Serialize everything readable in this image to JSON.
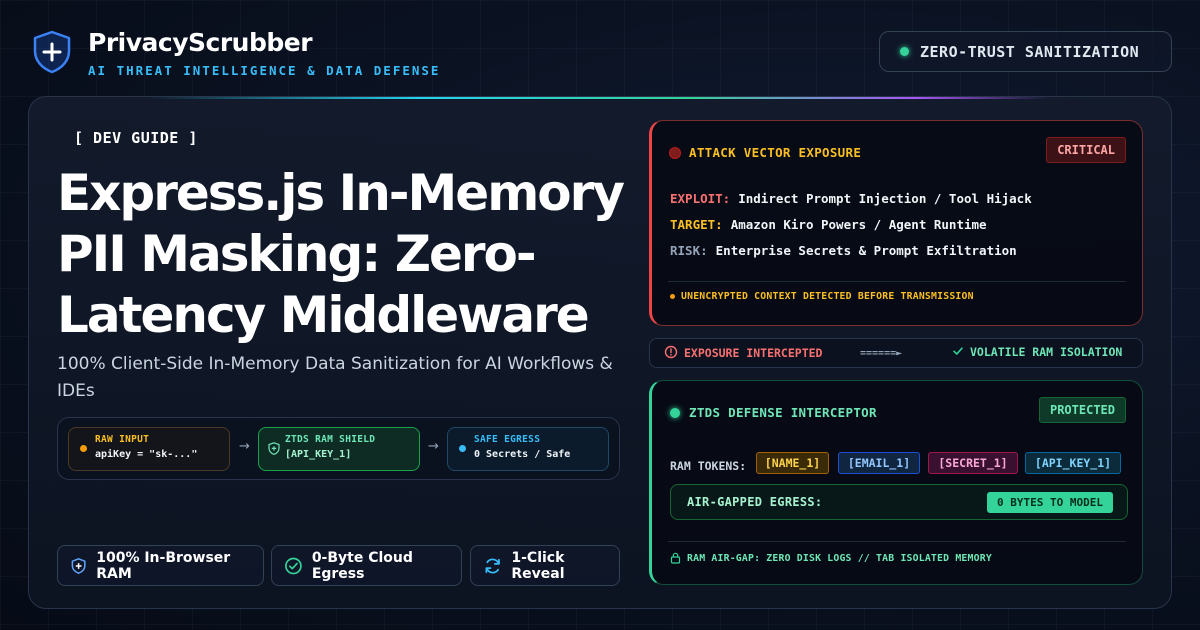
{
  "brand": {
    "name": "PrivacyScrubber",
    "tagline": "AI THREAT INTELLIGENCE & DATA DEFENSE",
    "status_pill": "ZERO-TRUST SANITIZATION"
  },
  "hero": {
    "tag": "[ DEV GUIDE ]",
    "headline": "Express.js In-Memory PII Masking: Zero-Latency Middleware",
    "subhead": "100% Client-Side In-Memory Data Sanitization for AI Workflows & IDEs"
  },
  "flow": {
    "steps": [
      {
        "title": "RAW INPUT",
        "value": "apiKey = \"sk-...\""
      },
      {
        "title": "ZTDS RAM SHIELD",
        "value": "[API_KEY_1]"
      },
      {
        "title": "SAFE EGRESS",
        "value": "0 Secrets / Safe"
      }
    ],
    "arrow": "→"
  },
  "features": [
    {
      "label": "100% In-Browser RAM",
      "icon": "shield-plus-icon"
    },
    {
      "label": "0-Byte Cloud Egress",
      "icon": "check-circle-icon"
    },
    {
      "label": "1-Click Reveal",
      "icon": "refresh-icon"
    }
  ],
  "attack_card": {
    "title": "ATTACK VECTOR EXPOSURE",
    "badge": "CRITICAL",
    "rows": [
      {
        "key": "EXPLOIT:",
        "value": "Indirect Prompt Injection / Tool Hijack"
      },
      {
        "key": "TARGET:",
        "value": "Amazon Kiro Powers / Agent Runtime"
      },
      {
        "key": "RISK:",
        "value": "Enterprise Secrets & Prompt Exfiltration"
      }
    ],
    "footer": "UNENCRYPTED CONTEXT DETECTED BEFORE TRANSMISSION"
  },
  "intercept_strip": {
    "left": "EXPOSURE INTERCEPTED",
    "arrow": "======►",
    "right": "VOLATILE RAM ISOLATION"
  },
  "defense_card": {
    "title": "ZTDS DEFENSE INTERCEPTOR",
    "badge": "PROTECTED",
    "tokens_label": "RAM TOKENS:",
    "tokens": [
      "[NAME_1]",
      "[EMAIL_1]",
      "[SECRET_1]",
      "[API_KEY_1]"
    ],
    "egress_label": "AIR-GAPPED EGRESS:",
    "egress_value": "0 BYTES TO MODEL",
    "footer": "RAM AIR-GAP: ZERO DISK LOGS // TAB ISOLATED MEMORY"
  },
  "colors": {
    "accent_cyan": "#38bdf8",
    "critical_red": "#ef4444",
    "protected_green": "#34d399",
    "warning_amber": "#fbbf24"
  }
}
